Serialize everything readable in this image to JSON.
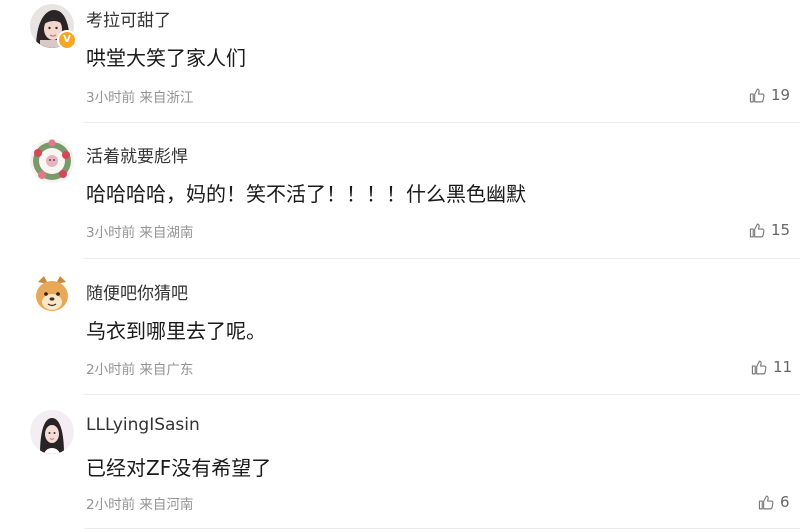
{
  "comments": [
    {
      "username": "考拉可甜了",
      "text": "哄堂大笑了家人们",
      "time": "3小时前",
      "location": "来自浙江",
      "likes": "19",
      "verified_badge": "V",
      "avatar": "woman-selfie-avatar",
      "badge_color": "#f5a623"
    },
    {
      "username": "活着就要彪悍",
      "text": "哈哈哈哈，妈的！笑不活了！！！！什么黑色幽默",
      "time": "3小时前",
      "location": "来自湖南",
      "likes": "15",
      "avatar": "floral-wreath-avatar"
    },
    {
      "username": "随便吧你猜吧",
      "text": "乌衣到哪里去了呢。",
      "time": "2小时前",
      "location": "来自广东",
      "likes": "11",
      "avatar": "cartoon-dog-avatar"
    },
    {
      "username": "LLLyingISasin",
      "text": "已经对ZF没有希望了",
      "time": "2小时前",
      "location": "来自河南",
      "likes": "6",
      "avatar": "girl-portrait-avatar"
    }
  ],
  "icons": {
    "like": "thumbs-up-icon"
  },
  "colors": {
    "text": "#1a1a1a",
    "meta": "#939393",
    "divider": "#ececec"
  }
}
